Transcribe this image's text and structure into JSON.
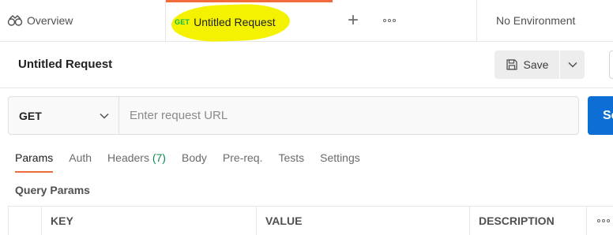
{
  "tabs": {
    "overview_label": "Overview",
    "active": {
      "method": "GET",
      "title": "Untitled Request"
    },
    "new_tab_symbol": "+",
    "environment": "No Environment"
  },
  "request": {
    "title": "Untitled Request",
    "save_label": "Save",
    "method": "GET",
    "url_placeholder": "Enter request URL",
    "url_value": "",
    "send_label": "Send"
  },
  "request_tabs": [
    {
      "label": "Params",
      "active": true
    },
    {
      "label": "Auth"
    },
    {
      "label": "Headers",
      "count": "(7)"
    },
    {
      "label": "Body"
    },
    {
      "label": "Pre-req."
    },
    {
      "label": "Tests"
    },
    {
      "label": "Settings"
    }
  ],
  "params": {
    "title": "Query Params",
    "columns": [
      "KEY",
      "VALUE",
      "DESCRIPTION"
    ]
  },
  "colors": {
    "accent": "#f26b3a",
    "highlight": "#f4f200",
    "send": "#0d6fd6",
    "get_method": "#0cbb52"
  },
  "icons": [
    "overview-icon",
    "plus-icon",
    "more-icon",
    "save-icon",
    "chevron-down-icon"
  ]
}
